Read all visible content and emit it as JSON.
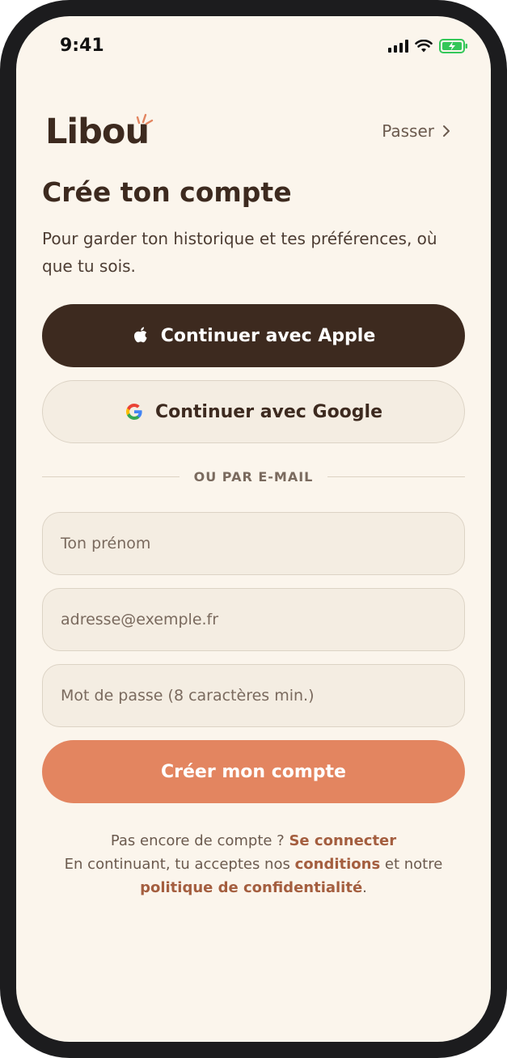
{
  "status_bar": {
    "time": "9:41"
  },
  "header": {
    "logo_text": "Libou",
    "skip_label": "Passer"
  },
  "main": {
    "title": "Crée ton compte",
    "subtitle": "Pour garder ton historique et tes préférences, où que tu sois."
  },
  "auth": {
    "apple_label": "Continuer avec Apple",
    "google_label": "Continuer avec Google",
    "divider_label": "OU PAR E-MAIL"
  },
  "form": {
    "name_placeholder": "Ton prénom",
    "email_placeholder": "adresse@exemple.fr",
    "password_placeholder": "Mot de passe (8 caractères min.)",
    "submit_label": "Créer mon compte"
  },
  "footer": {
    "have_account_text": "Pas encore de compte ?",
    "login_link": "Se connecter",
    "terms_prefix": "En continuant, tu acceptes nos",
    "terms_link": "conditions",
    "terms_middle": "et notre",
    "privacy_link": "politique de confidentialité",
    "terms_suffix": "."
  },
  "colors": {
    "background": "#fbf5ec",
    "primary_dark": "#3d2a1f",
    "accent": "#e38560",
    "link": "#a45e3f",
    "field_bg": "#f4ede2"
  },
  "icons": {
    "apple": "apple-icon",
    "google": "google-icon",
    "skip": "chevron-right-icon",
    "signal": "cellular-signal-icon",
    "wifi": "wifi-icon",
    "battery": "battery-charging-icon"
  }
}
